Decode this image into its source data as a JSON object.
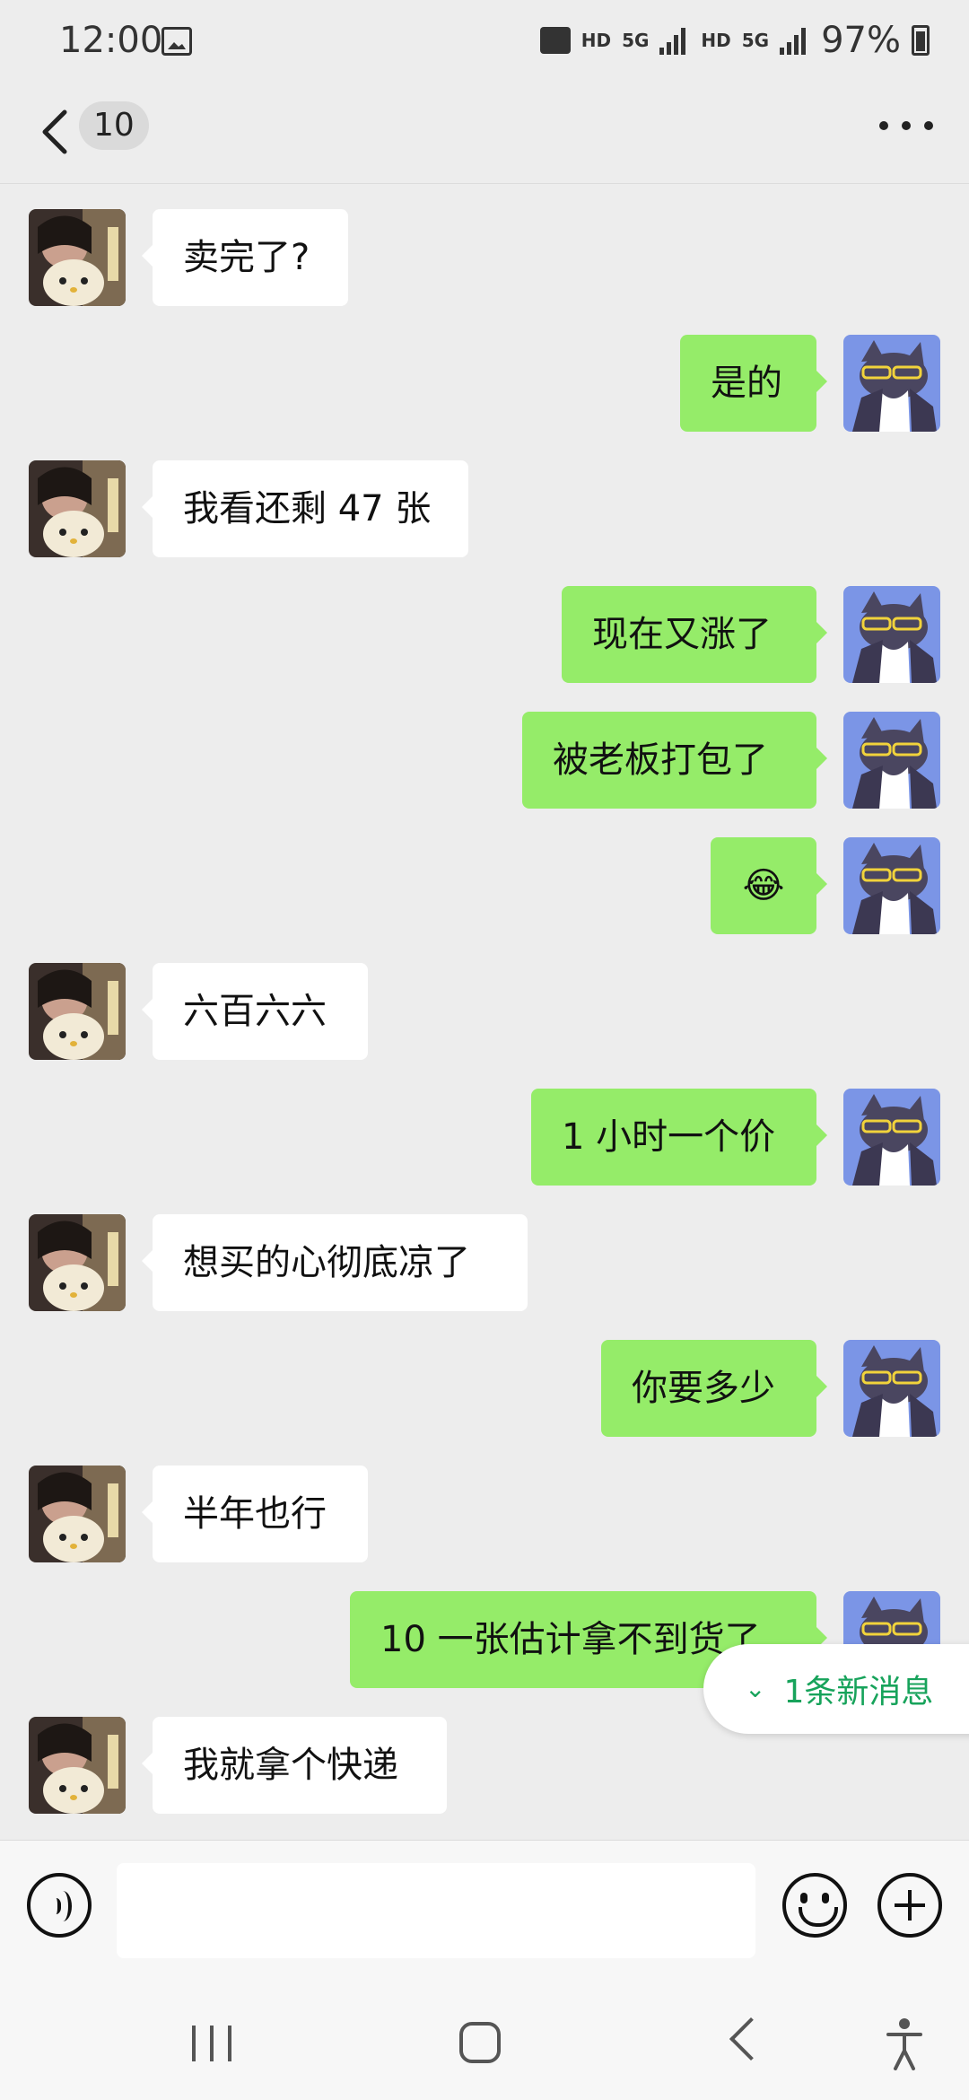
{
  "status_bar": {
    "time": "12:00",
    "network_1": "HD",
    "network_2": "5G",
    "network_3": "HD",
    "network_4": "5G",
    "battery": "97%"
  },
  "header": {
    "unread_count": "10"
  },
  "messages": [
    {
      "side": "in",
      "text": "卖完了?"
    },
    {
      "side": "out",
      "text": "是的"
    },
    {
      "side": "in",
      "text": "我看还剩 47 张"
    },
    {
      "side": "out",
      "text": "现在又涨了"
    },
    {
      "side": "out",
      "text": "被老板打包了"
    },
    {
      "side": "out",
      "text": "😂"
    },
    {
      "side": "in",
      "text": "六百六六"
    },
    {
      "side": "out",
      "text": "1 小时一个价"
    },
    {
      "side": "in",
      "text": "想买的心彻底凉了"
    },
    {
      "side": "out",
      "text": "你要多少"
    },
    {
      "side": "in",
      "text": "半年也行"
    },
    {
      "side": "out",
      "text": "10 一张估计拿不到货了"
    },
    {
      "side": "in",
      "text": "我就拿个快递"
    }
  ],
  "new_message_pill": {
    "label": "1条新消息",
    "icon": "double-chevron-down-icon"
  },
  "colors": {
    "incoming_bubble": "#ffffff",
    "outgoing_bubble": "#95ec69",
    "background": "#ededed",
    "accent_green": "#17a35b"
  }
}
